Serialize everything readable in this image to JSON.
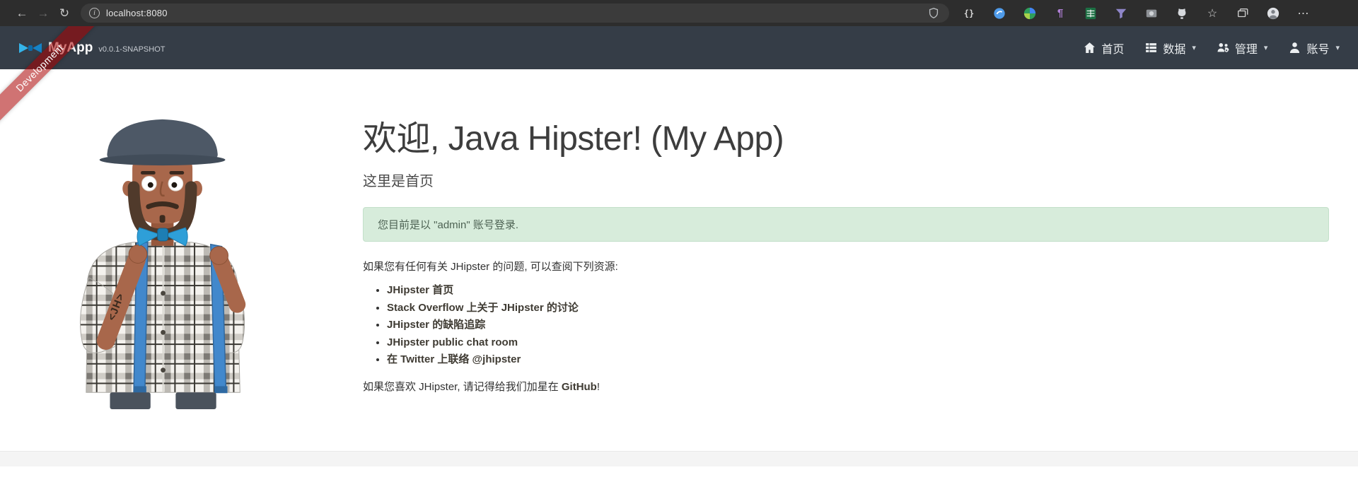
{
  "browser": {
    "url": "localhost:8080",
    "back_icon": "←",
    "forward_icon": "→",
    "refresh_icon": "↻",
    "info_icon": "i",
    "braces_icon": "{}",
    "pilcrow_icon": "¶",
    "star_icon": "☆",
    "ellipsis_icon": "⋯"
  },
  "navbar": {
    "brand": "MyApp",
    "version": "v0.0.1-SNAPSHOT",
    "caret": "▾",
    "items": [
      {
        "label": "首页"
      },
      {
        "label": "数据"
      },
      {
        "label": "管理"
      },
      {
        "label": "账号"
      }
    ]
  },
  "ribbon": {
    "label": "Development"
  },
  "home": {
    "title": "欢迎, Java Hipster! (My App)",
    "subtitle": "这里是首页",
    "alert_text": "您目前是以 \"admin\" 账号登录.",
    "resources_intro": "如果您有任何有关 JHipster 的问题, 可以查阅下列资源:",
    "links": [
      {
        "label": "JHipster 首页"
      },
      {
        "label": "Stack Overflow 上关于 JHipster 的讨论"
      },
      {
        "label": "JHipster 的缺陷追踪"
      },
      {
        "label": "JHipster public chat room"
      },
      {
        "label": "在 Twitter 上联络 @jhipster"
      }
    ],
    "star_prefix": "如果您喜欢 JHipster, 请记得给我们加星在 ",
    "star_link": "GitHub",
    "star_suffix": "!"
  }
}
